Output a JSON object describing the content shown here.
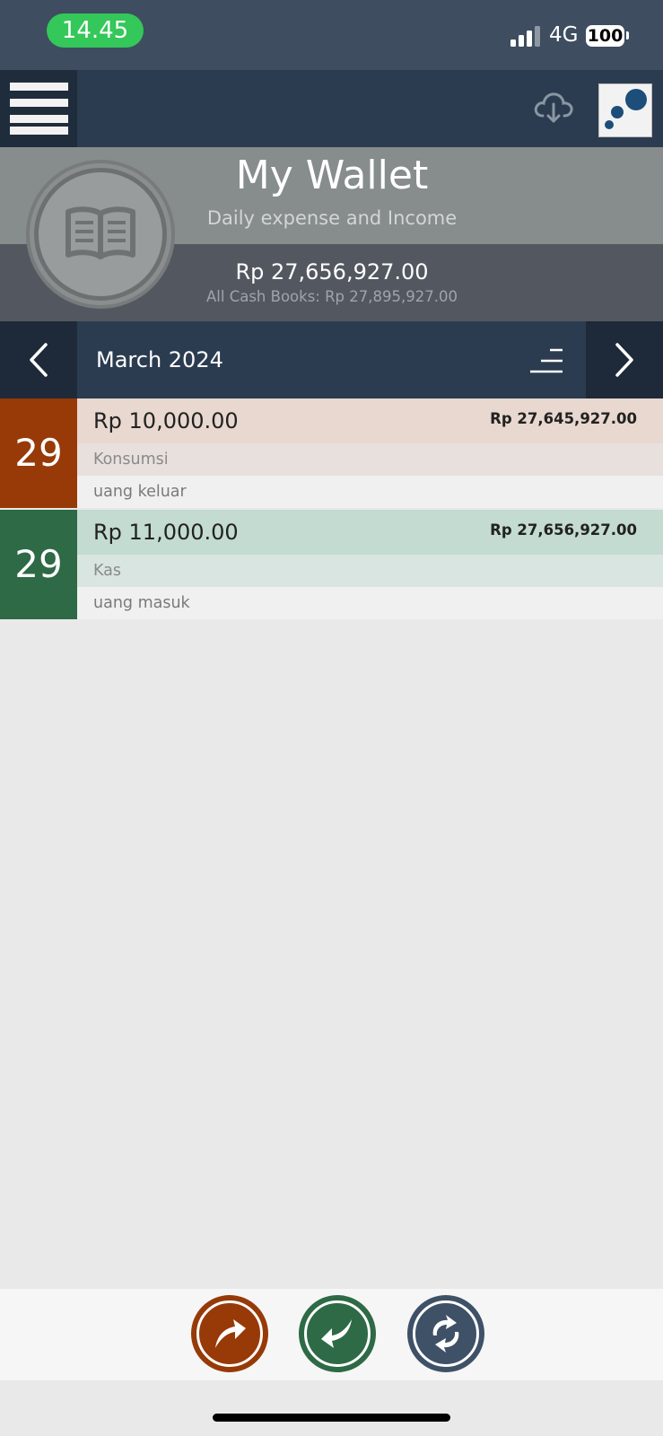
{
  "status_bar": {
    "time": "14.45",
    "network": "4G",
    "battery": "100"
  },
  "toolbar": {
    "menu_icon": "hamburger-icon",
    "download_icon": "cloud-download-icon",
    "logo_icon": "app-logo"
  },
  "wallet": {
    "icon": "book-icon",
    "title": "My Wallet",
    "subtitle": "Daily expense and Income",
    "balance": "Rp 27,656,927.00",
    "all_cash_books": "All Cash Books: Rp 27,895,927.00"
  },
  "month_nav": {
    "label": "March 2024",
    "prev_icon": "chevron-left-icon",
    "next_icon": "chevron-right-icon",
    "sort_icon": "sort-icon"
  },
  "transactions": [
    {
      "date": "29",
      "amount": "Rp 10,000.00",
      "running_balance": "Rp 27,645,927.00",
      "category": "Konsumsi",
      "note": "uang keluar",
      "type": "expense",
      "colors": {
        "date_bg": "#973a08",
        "amount_bg": "#e8d8cf",
        "category_bg": "#e8e0dd"
      }
    },
    {
      "date": "29",
      "amount": "Rp 11,000.00",
      "running_balance": "Rp 27,656,927.00",
      "category": "Kas",
      "note": "uang masuk",
      "type": "income",
      "colors": {
        "date_bg": "#2d6a45",
        "amount_bg": "#c3dbd0",
        "category_bg": "#d9e5e0"
      }
    }
  ],
  "actions": [
    {
      "name": "add-expense",
      "icon": "arrow-up-right-icon",
      "color": "#973a08"
    },
    {
      "name": "add-income",
      "icon": "arrow-down-left-icon",
      "color": "#2d6a45"
    },
    {
      "name": "transfer",
      "icon": "refresh-icon",
      "color": "#3e5166"
    }
  ]
}
